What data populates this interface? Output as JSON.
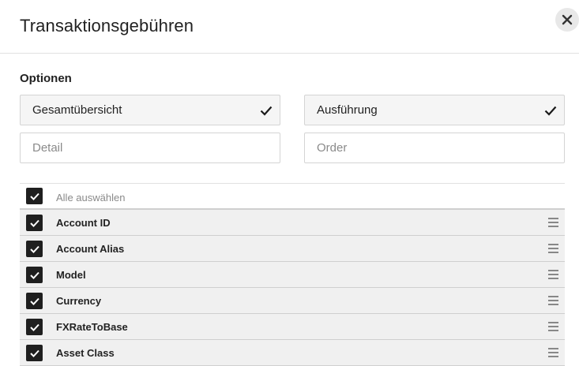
{
  "dialog": {
    "title": "Transaktionsgebühren"
  },
  "options": {
    "label": "Optionen",
    "items": [
      {
        "label": "Gesamtübersicht",
        "selected": true
      },
      {
        "label": "Ausführung",
        "selected": true
      },
      {
        "label": "Detail",
        "selected": false
      },
      {
        "label": "Order",
        "selected": false
      }
    ]
  },
  "fields": {
    "select_all_label": "Alle auswählen",
    "rows": [
      {
        "label": "Account ID",
        "checked": true
      },
      {
        "label": "Account Alias",
        "checked": true
      },
      {
        "label": "Model",
        "checked": true
      },
      {
        "label": "Currency",
        "checked": true
      },
      {
        "label": "FXRateToBase",
        "checked": true
      },
      {
        "label": "Asset Class",
        "checked": true
      }
    ]
  }
}
